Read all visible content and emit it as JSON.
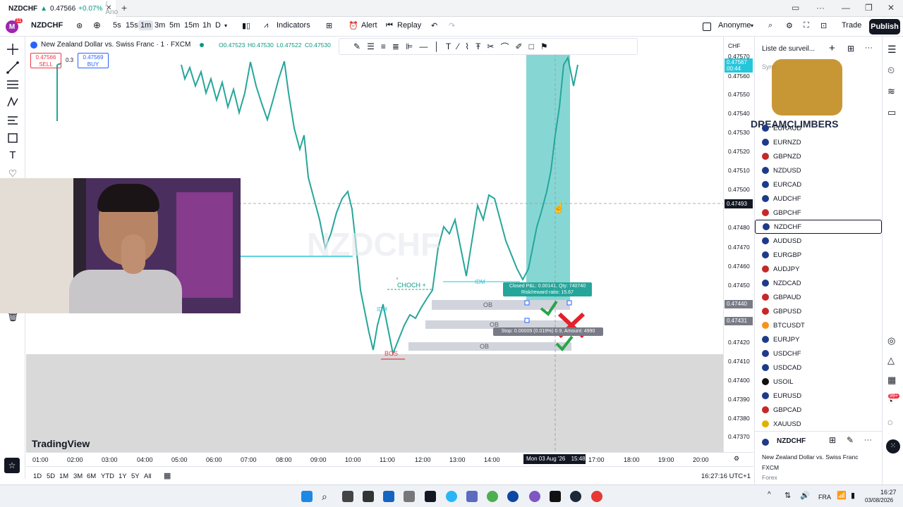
{
  "browser": {
    "tab_title": "NZDCHF",
    "tab_price": "0.47566",
    "tab_change": "+0.07%",
    "tab_suffix": "/ Ano",
    "new_tab": "+"
  },
  "header": {
    "notification_count": "11",
    "symbol": "NZDCHF",
    "timeframes": [
      "5s",
      "15s",
      "1m",
      "3m",
      "5m",
      "15m",
      "1h",
      "D"
    ],
    "active_timeframe": "1m",
    "indicators_label": "Indicators",
    "alert_label": "Alert",
    "replay_label": "Replay",
    "layout_name": "Anonyme",
    "trade_label": "Trade",
    "publish_label": "Publish"
  },
  "legend": {
    "title": "New Zealand Dollar vs. Swiss Franc · 1 · FXCM",
    "o": "O0.47523",
    "h": "H0.47530",
    "l": "L0.47522",
    "c": "C0.47530",
    "sell_price": "0.47566",
    "sell_label": "SELL",
    "spread": "0.3",
    "buy_price": "0.47569",
    "buy_label": "BUY"
  },
  "chart": {
    "watermark": "NZDCHF",
    "logo": "TradingView",
    "currency": "CHF",
    "crosshair_price": "0.47493",
    "current_price": "0.47567",
    "countdown": "00:44",
    "price_tags": [
      "0.47440",
      "0.47431"
    ],
    "price_labels": [
      "0.47570",
      "0.47560",
      "0.47550",
      "0.47540",
      "0.47530",
      "0.47520",
      "0.47510",
      "0.47500",
      "0.47480",
      "0.47470",
      "0.47460",
      "0.47450",
      "0.47420",
      "0.47410",
      "0.47400",
      "0.47390",
      "0.47380",
      "0.47370"
    ],
    "time_labels": [
      "01:00",
      "02:00",
      "03:00",
      "04:00",
      "05:00",
      "06:00",
      "07:00",
      "08:00",
      "09:00",
      "10:00",
      "11:00",
      "12:00",
      "13:00",
      "14:00",
      "17:00",
      "18:00",
      "19:00",
      "20:00"
    ],
    "cursor_date": "Mon 03 Aug '26",
    "cursor_time": "15:48",
    "annotations": {
      "choch": "CHOCH +",
      "idm1": "IDM",
      "idm2": "IDM",
      "bos": "BOS",
      "ob1": "OB",
      "ob2": "OB",
      "ob3": "OB",
      "closed_pnl": "Closed P&L: 0.00141, Qty: 740740",
      "risk_reward": "Risk/reward ratio: 15.67",
      "stop": "Stop: 0.00009 (0.019%) 0.9, Amount: 4990"
    },
    "colors": {
      "target_zone": "#5ec9c6",
      "target_zone_light": "#b2e6e4",
      "order_block": "#d1d4dc",
      "candles": "#26a69a",
      "bos": "#f23645",
      "check": "#26a648",
      "cross": "#e3212d"
    }
  },
  "bottom_bar": {
    "ranges": [
      "1D",
      "5D",
      "1M",
      "3M",
      "6M",
      "YTD",
      "1Y",
      "5Y",
      "All"
    ],
    "clock": "16:27:16 UTC+1"
  },
  "watchlist": {
    "title": "Liste de surveil...",
    "column_symbol": "Symb",
    "overlay_brand": "DREAMCLIMBERS",
    "items": [
      {
        "symbol": "EURAUD"
      },
      {
        "symbol": "EURNZD"
      },
      {
        "symbol": "GBPNZD"
      },
      {
        "symbol": "NZDUSD"
      },
      {
        "symbol": "EURCAD"
      },
      {
        "symbol": "AUDCHF"
      },
      {
        "symbol": "GBPCHF"
      },
      {
        "symbol": "NZDCHF"
      },
      {
        "symbol": "AUDUSD"
      },
      {
        "symbol": "EURGBP"
      },
      {
        "symbol": "AUDJPY"
      },
      {
        "symbol": "NZDCAD"
      },
      {
        "symbol": "GBPAUD"
      },
      {
        "symbol": "GBPUSD"
      },
      {
        "symbol": "BTCUSDT"
      },
      {
        "symbol": "EURJPY"
      },
      {
        "symbol": "USDCHF"
      },
      {
        "symbol": "USDCAD"
      },
      {
        "symbol": "USOIL"
      },
      {
        "symbol": "EURUSD"
      },
      {
        "symbol": "GBPCAD"
      },
      {
        "symbol": "XAUUSD"
      }
    ],
    "selected": "NZDCHF",
    "details": {
      "symbol": "NZDCHF",
      "name": "New Zealand Dollar vs. Swiss Franc",
      "exchange": "FXCM",
      "type": "Forex"
    },
    "alerts_badge": "99+"
  },
  "taskbar": {
    "lang": "FRA",
    "time": "16:27",
    "date": "03/08/2026"
  }
}
